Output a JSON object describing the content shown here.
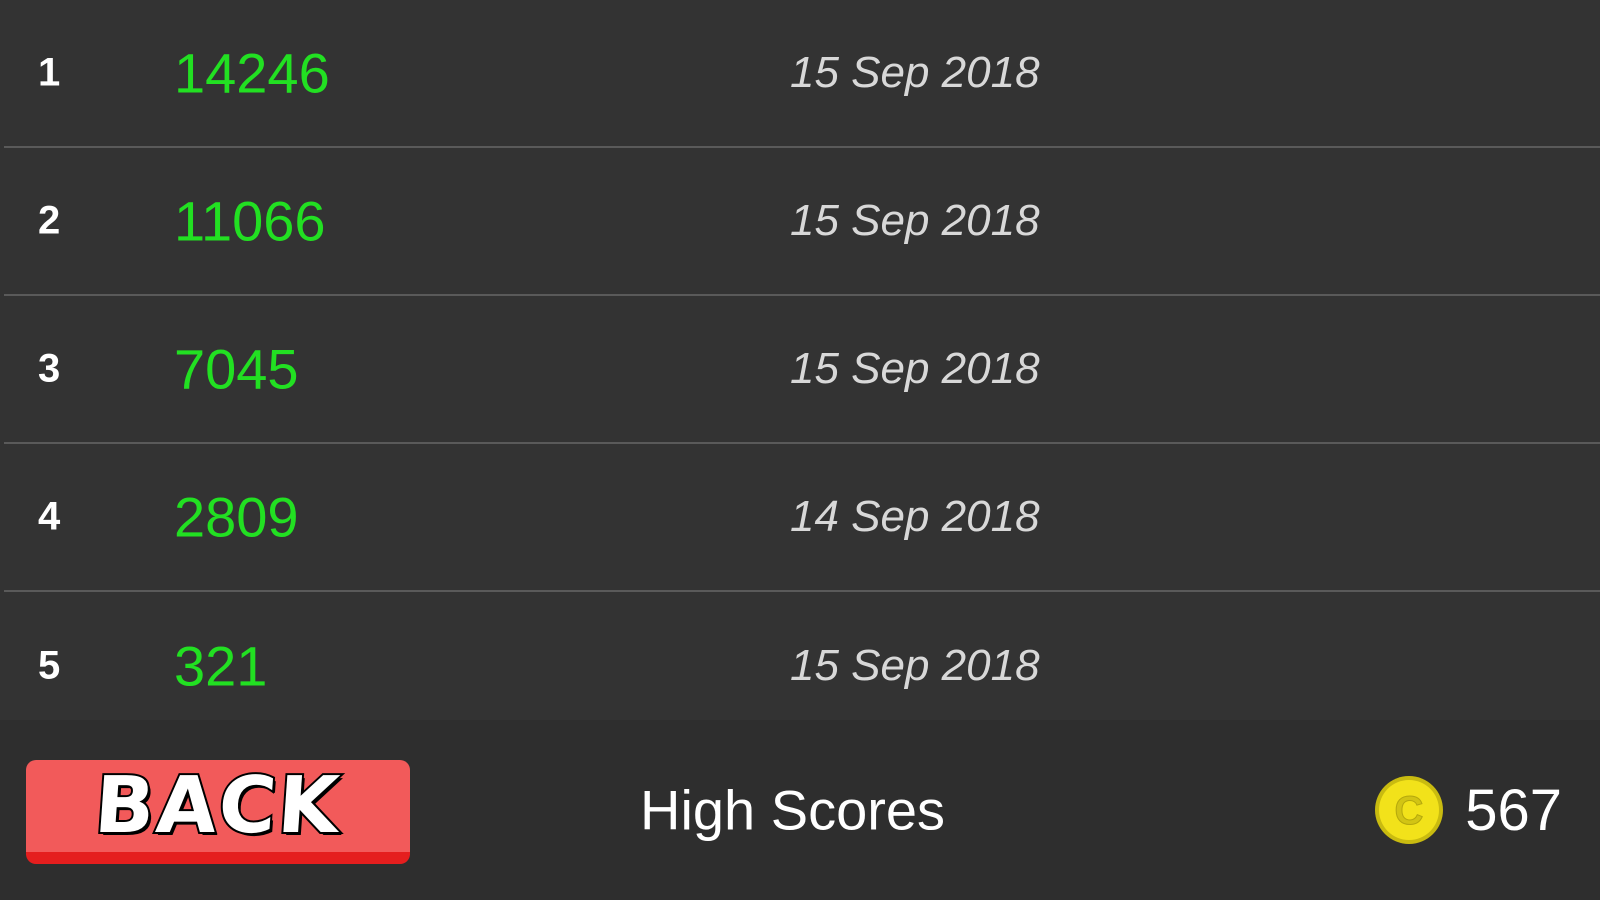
{
  "scores": [
    {
      "rank": "1",
      "score": "14246",
      "date": "15 Sep 2018"
    },
    {
      "rank": "2",
      "score": "11066",
      "date": "15 Sep 2018"
    },
    {
      "rank": "3",
      "score": "7045",
      "date": "15 Sep 2018"
    },
    {
      "rank": "4",
      "score": "2809",
      "date": "14 Sep 2018"
    },
    {
      "rank": "5",
      "score": "321",
      "date": "15 Sep 2018"
    }
  ],
  "footer": {
    "back_label": "BACK",
    "title": "High Scores",
    "coin_icon": "coin-icon",
    "coin_count": "567"
  },
  "colors": {
    "background": "#333333",
    "score_green": "#22e022",
    "back_button": "#f25a5a",
    "coin_yellow": "#f2e21a"
  }
}
